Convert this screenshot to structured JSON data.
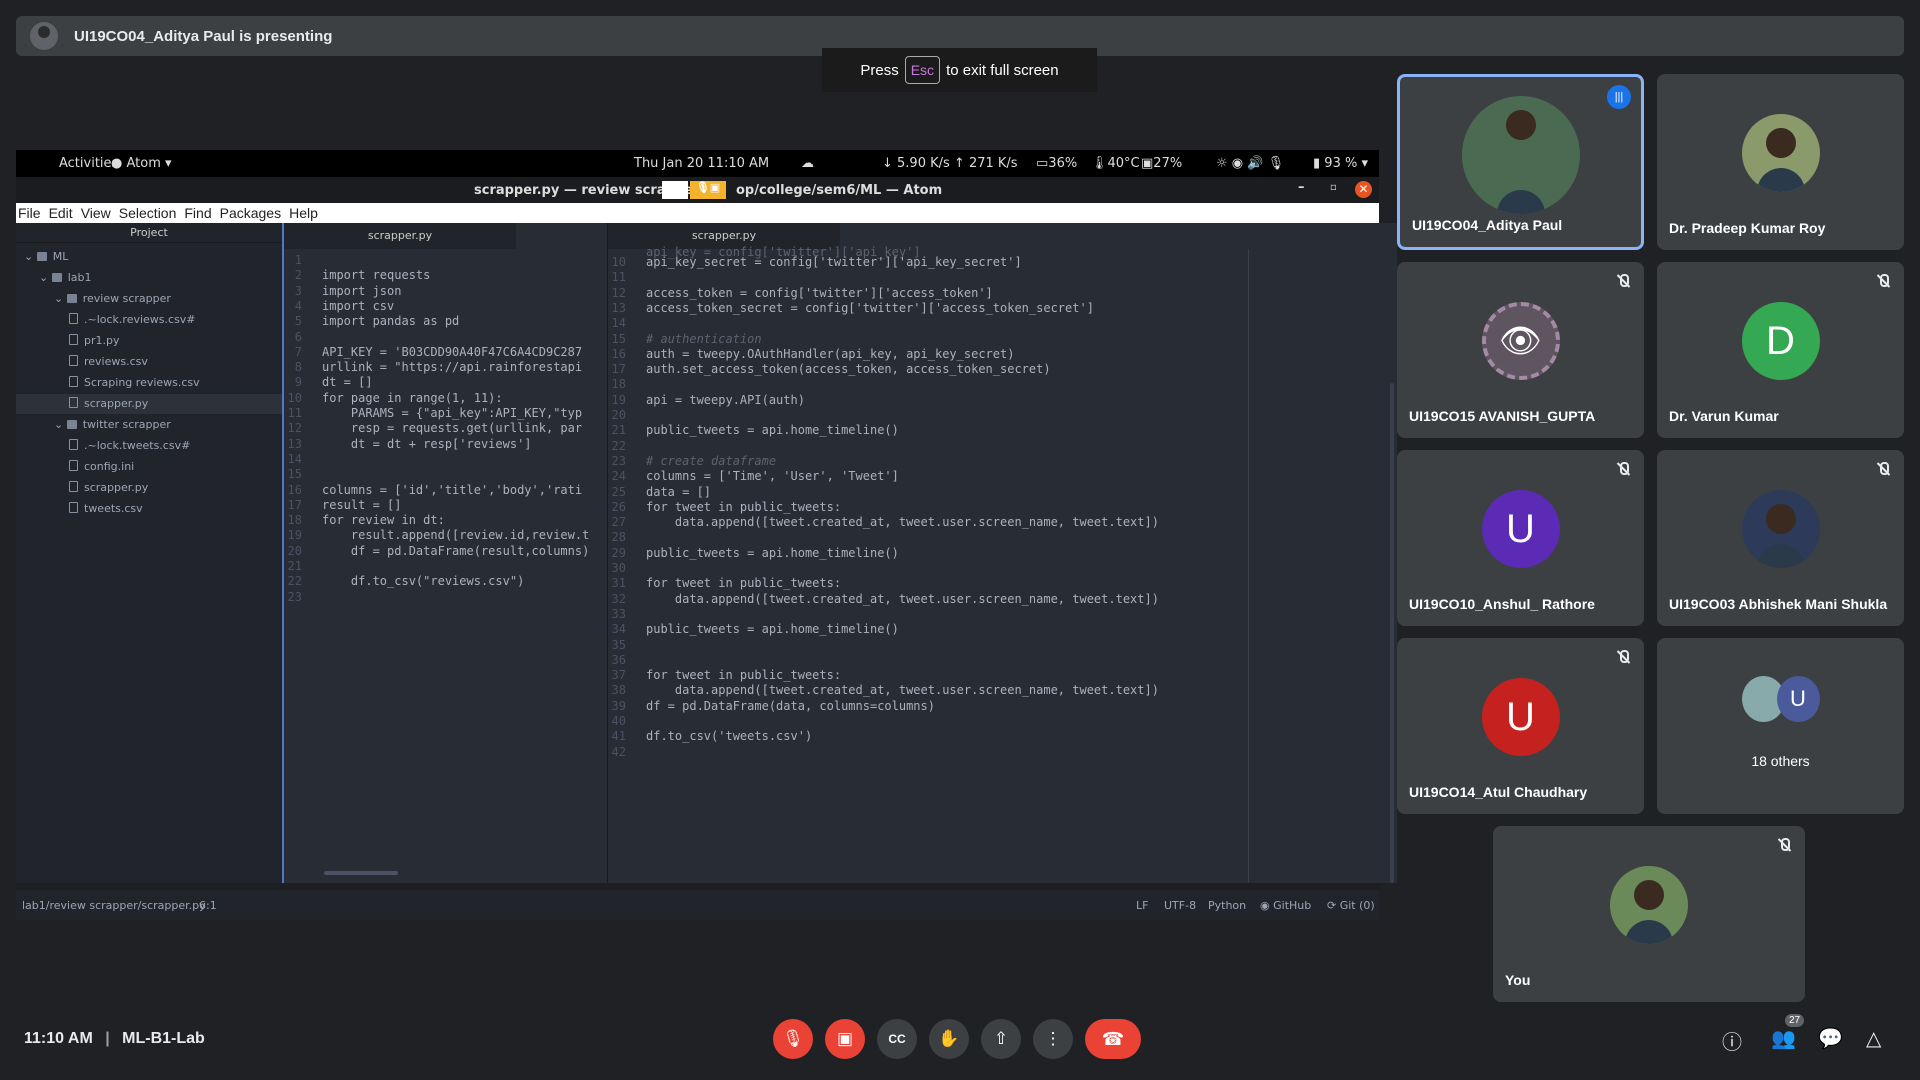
{
  "presenting": "UI19CO04_Aditya Paul is presenting",
  "esc": {
    "pre": "Press",
    "key": "Esc",
    "post": "to exit full screen"
  },
  "gnome": {
    "activities": "Activities",
    "app": "Atom",
    "datetime": "Thu Jan 20  11:10 AM",
    "net": "↓ 5.90 K/s ↑ 271 K/s",
    "cpu": "36%",
    "temp": "40°C",
    "mem": "27%",
    "battery": "93 %"
  },
  "atom": {
    "title_left": "scrapper.py — review scrappe",
    "title_right": "op/college/sem6/ML — Atom",
    "menu": [
      "File",
      "Edit",
      "View",
      "Selection",
      "Find",
      "Packages",
      "Help"
    ],
    "project_header": "Project",
    "tree": [
      {
        "t": "ML",
        "d": 0,
        "dir": true
      },
      {
        "t": "lab1",
        "d": 1,
        "dir": true
      },
      {
        "t": "review scrapper",
        "d": 2,
        "dir": true
      },
      {
        "t": ".~lock.reviews.csv#",
        "d": 3
      },
      {
        "t": "pr1.py",
        "d": 3
      },
      {
        "t": "reviews.csv",
        "d": 3
      },
      {
        "t": "Scraping reviews.csv",
        "d": 3
      },
      {
        "t": "scrapper.py",
        "d": 3,
        "sel": true
      },
      {
        "t": "twitter scrapper",
        "d": 2,
        "dir": true
      },
      {
        "t": ".~lock.tweets.csv#",
        "d": 3
      },
      {
        "t": "config.ini",
        "d": 3
      },
      {
        "t": "scrapper.py",
        "d": 3
      },
      {
        "t": "tweets.csv",
        "d": 3
      }
    ],
    "tab_left": "scrapper.py",
    "tab_right": "scrapper.py",
    "left_code": [
      [
        1,
        ""
      ],
      [
        2,
        "import requests"
      ],
      [
        3,
        "import json"
      ],
      [
        4,
        "import csv"
      ],
      [
        5,
        "import pandas as pd"
      ],
      [
        6,
        ""
      ],
      [
        7,
        "API_KEY = 'B03CDD90A40F47C6A4CD9C287"
      ],
      [
        8,
        "urllink = \"https://api.rainforestapi"
      ],
      [
        9,
        "dt = []"
      ],
      [
        10,
        "for page in range(1, 11):"
      ],
      [
        11,
        "    PARAMS = {\"api_key\":API_KEY,\"typ"
      ],
      [
        12,
        "    resp = requests.get(urllink, par"
      ],
      [
        13,
        "    dt = dt + resp['reviews']"
      ],
      [
        14,
        ""
      ],
      [
        15,
        ""
      ],
      [
        16,
        "columns = ['id','title','body','rati"
      ],
      [
        17,
        "result = []"
      ],
      [
        18,
        "for review in dt:"
      ],
      [
        19,
        "    result.append([review.id,review.t"
      ],
      [
        20,
        "    df = pd.DataFrame(result,columns)"
      ],
      [
        21,
        ""
      ],
      [
        22,
        "    df.to_csv(\"reviews.csv\")"
      ],
      [
        23,
        ""
      ]
    ],
    "right_code": [
      [
        10,
        "api_key_secret = config['twitter']['api_key_secret']"
      ],
      [
        11,
        ""
      ],
      [
        12,
        "access_token = config['twitter']['access_token']"
      ],
      [
        13,
        "access_token_secret = config['twitter']['access_token_secret']"
      ],
      [
        14,
        ""
      ],
      [
        15,
        "# authentication"
      ],
      [
        16,
        "auth = tweepy.OAuthHandler(api_key, api_key_secret)"
      ],
      [
        17,
        "auth.set_access_token(access_token, access_token_secret)"
      ],
      [
        18,
        ""
      ],
      [
        19,
        "api = tweepy.API(auth)"
      ],
      [
        20,
        ""
      ],
      [
        21,
        "public_tweets = api.home_timeline()"
      ],
      [
        22,
        ""
      ],
      [
        23,
        "# create dataframe"
      ],
      [
        24,
        "columns = ['Time', 'User', 'Tweet']"
      ],
      [
        25,
        "data = []"
      ],
      [
        26,
        "for tweet in public_tweets:"
      ],
      [
        27,
        "    data.append([tweet.created_at, tweet.user.screen_name, tweet.text])"
      ],
      [
        28,
        ""
      ],
      [
        29,
        "public_tweets = api.home_timeline()"
      ],
      [
        30,
        ""
      ],
      [
        31,
        "for tweet in public_tweets:"
      ],
      [
        32,
        "    data.append([tweet.created_at, tweet.user.screen_name, tweet.text])"
      ],
      [
        33,
        ""
      ],
      [
        34,
        "public_tweets = api.home_timeline()"
      ],
      [
        35,
        ""
      ],
      [
        36,
        ""
      ],
      [
        37,
        "for tweet in public_tweets:"
      ],
      [
        38,
        "    data.append([tweet.created_at, tweet.user.screen_name, tweet.text])"
      ],
      [
        39,
        "df = pd.DataFrame(data, columns=columns)"
      ],
      [
        40,
        ""
      ],
      [
        41,
        "df.to_csv('tweets.csv')"
      ],
      [
        42,
        ""
      ]
    ],
    "status": {
      "path": "lab1/review scrapper/scrapper.py",
      "pos": "6:1",
      "lf": "LF",
      "enc": "UTF-8",
      "lang": "Python",
      "github": "GitHub",
      "git": "Git (0)"
    }
  },
  "participants": [
    {
      "name": "UI19CO04_Aditya Paul",
      "avatar": "photo",
      "color": "#4a6b52",
      "active": true
    },
    {
      "name": "Dr. Pradeep Kumar Roy",
      "avatar": "photo",
      "color": "#8a9a6a"
    },
    {
      "name": "UI19CO15 AVANISH_GUPTA",
      "avatar": "eye",
      "color": "#5f5560",
      "muted": true
    },
    {
      "name": "Dr. Varun Kumar",
      "avatar": "D",
      "color": "#34a853",
      "muted": true
    },
    {
      "name": "UI19CO10_Anshul_ Rathore",
      "avatar": "U",
      "color": "#5b2bb5",
      "muted": true
    },
    {
      "name": "UI19CO03 Abhishek Mani Shukla",
      "avatar": "photo",
      "color": "#2d3a5a",
      "muted": true
    },
    {
      "name": "UI19CO14_Atul Chaudhary",
      "avatar": "U",
      "color": "#c5221f",
      "muted": true
    },
    {
      "name": "18 others",
      "avatar": "group",
      "color": "#4a5a8a"
    },
    {
      "name": "You",
      "avatar": "photo",
      "color": "#6a8a5a",
      "muted": true
    }
  ],
  "meeting": {
    "time": "11:10 AM",
    "code": "ML-B1-Lab",
    "people_count": "27"
  },
  "colors": {
    "active_border": "#8ab4f8",
    "end_call": "#ea4335"
  }
}
